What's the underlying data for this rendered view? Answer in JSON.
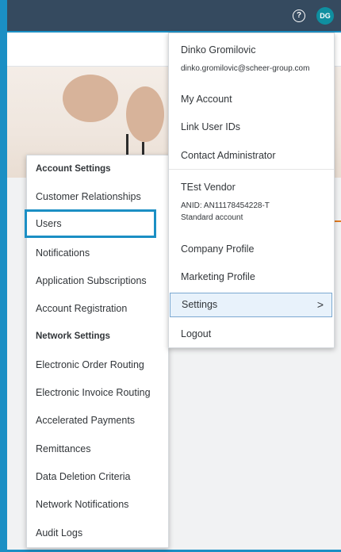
{
  "topbar": {
    "help_glyph": "?",
    "avatar_initials": "DG"
  },
  "account_menu": {
    "user_name": "Dinko Gromilovic",
    "user_email": "dinko.gromilovic@scheer-group.com",
    "my_account": "My Account",
    "link_user_ids": "Link User IDs",
    "contact_admin": "Contact Administrator",
    "company_name": "TEst Vendor",
    "anid": "ANID: AN11178454228-T",
    "account_type": "Standard account",
    "company_profile": "Company Profile",
    "marketing_profile": "Marketing Profile",
    "settings": "Settings",
    "settings_chevron": ">",
    "logout": "Logout"
  },
  "settings_menu": {
    "account_settings_header": "Account Settings",
    "customer_relationships": "Customer Relationships",
    "users": "Users",
    "notifications": "Notifications",
    "application_subscriptions": "Application Subscriptions",
    "account_registration": "Account Registration",
    "network_settings_header": "Network Settings",
    "electronic_order_routing": "Electronic Order Routing",
    "electronic_invoice_routing": "Electronic Invoice Routing",
    "accelerated_payments": "Accelerated Payments",
    "remittances": "Remittances",
    "data_deletion_criteria": "Data Deletion Criteria",
    "network_notifications": "Network Notifications",
    "audit_logs": "Audit Logs"
  },
  "colors": {
    "topbar": "#354a5f",
    "highlight": "#1b8fc4",
    "avatar": "#0f8fa0",
    "callout": "#e07a1f"
  }
}
